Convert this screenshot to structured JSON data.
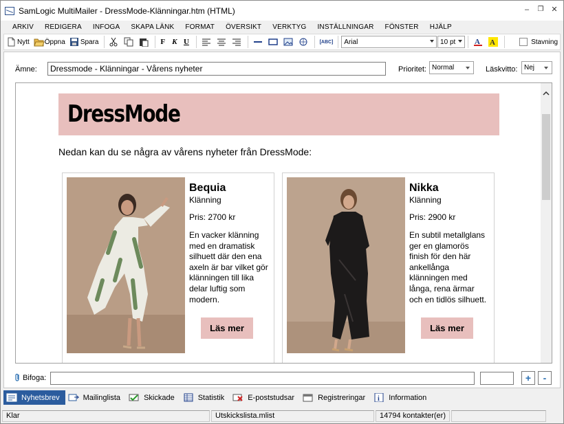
{
  "window": {
    "title": "SamLogic MultiMailer - DressMode-Klänningar.htm  (HTML)"
  },
  "menu": [
    "ARKIV",
    "REDIGERA",
    "INFOGA",
    "SKAPA LÄNK",
    "FORMAT",
    "ÖVERSIKT",
    "VERKTYG",
    "INSTÄLLNINGAR",
    "FÖNSTER",
    "HJÄLP"
  ],
  "toolbar": {
    "new_label": "Nytt",
    "open_label": "Öppna",
    "save_label": "Spara",
    "bold": "F",
    "italic": "K",
    "underline": "U",
    "font": "Arial",
    "size": "10 pt",
    "spell_label": "Stavning",
    "spell_icon_text": "[ABC]"
  },
  "header": {
    "subject_label": "Ämne:",
    "subject_value": "Dressmode - Klänningar - Vårens nyheter",
    "priority_label": "Prioritet:",
    "priority_value": "Normal",
    "read_receipt_label": "Läskvitto:",
    "read_receipt_value": "Nej"
  },
  "newsletter": {
    "brand": "DressMode",
    "intro": "Nedan kan du se några av vårens nyheter från DressMode:",
    "products": [
      {
        "name": "Bequia",
        "type": "Klänning",
        "price": "Pris: 2700 kr",
        "description": "En vacker klänning med en dramatisk silhuett där den ena axeln är bar vilket gör klänningen till lika delar luftig som modern.",
        "button": "Läs mer"
      },
      {
        "name": "Nikka",
        "type": "Klänning",
        "price": "Pris: 2900 kr",
        "description": "En subtil metallglans ger en glamorös finish för den här ankellånga klänningen med långa, rena ärmar och en tidlös silhuett.",
        "button": "Läs mer"
      }
    ]
  },
  "attach": {
    "label": "Bifoga:",
    "add": "+",
    "remove": "-"
  },
  "tabs": [
    "Nyhetsbrev",
    "Mailinglista",
    "Skickade",
    "Statistik",
    "E-poststudsar",
    "Registreringar",
    "Information"
  ],
  "status": {
    "state": "Klar",
    "list": "Utskickslista.mlist",
    "contacts": "14794 kontakter(er)"
  },
  "colors": {
    "banner": "#e8bfbd",
    "active_tab": "#2b5c9e",
    "accent": "#2a6fb2"
  }
}
